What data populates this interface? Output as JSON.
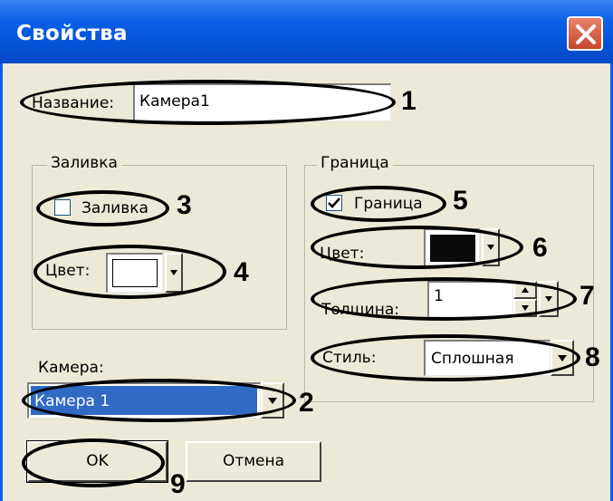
{
  "window": {
    "title": "Свойства"
  },
  "name_field": {
    "label": "Название:",
    "value": "Камера1"
  },
  "fill_group": {
    "title": "Заливка",
    "checkbox_label": "Заливка",
    "checked": false,
    "color_label": "Цвет:",
    "color": "#ffffff"
  },
  "border_group": {
    "title": "Граница",
    "checkbox_label": "Граница",
    "checked": true,
    "color_label": "Цвет:",
    "color": "#000000",
    "thickness_label": "Толщина:",
    "thickness_value": "1",
    "style_label": "Стиль:",
    "style_value": "Сплошная"
  },
  "camera": {
    "label": "Камера:",
    "value": "Камера 1"
  },
  "buttons": {
    "ok": "OK",
    "cancel": "Отмена"
  },
  "callouts": [
    "1",
    "2",
    "3",
    "4",
    "5",
    "6",
    "7",
    "8",
    "9"
  ],
  "colors": {
    "titlebar": "#0552d8",
    "face": "#ece9d8",
    "selection": "#316ac5"
  }
}
